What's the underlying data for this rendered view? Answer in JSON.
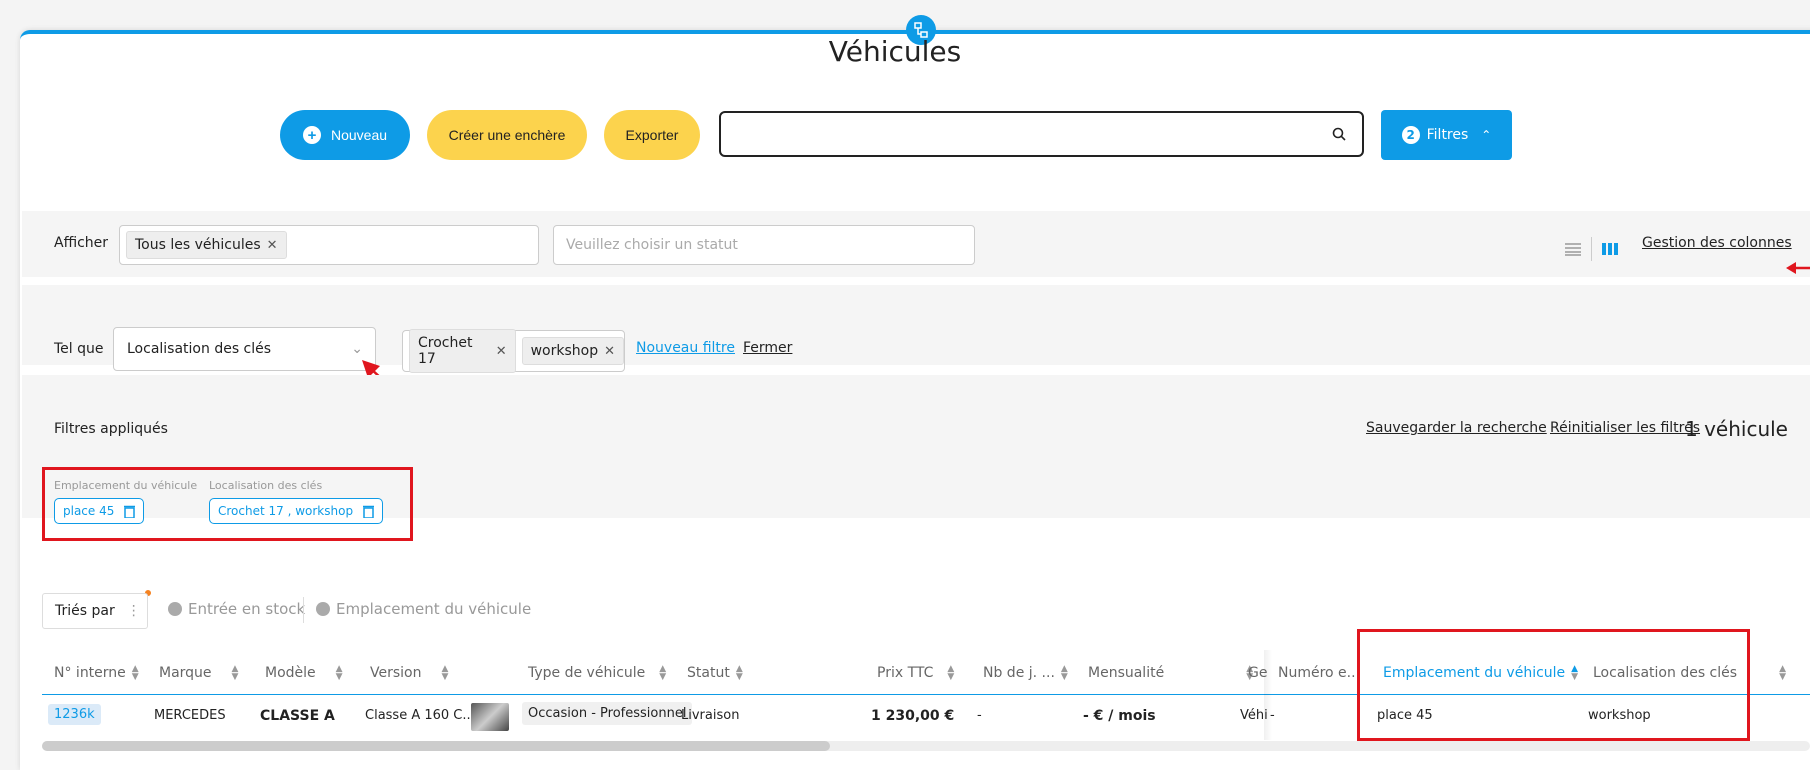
{
  "page": {
    "title": "Véhicules"
  },
  "toolbar": {
    "new_label": "Nouveau",
    "auction_label": "Créer une enchère",
    "export_label": "Exporter",
    "search_value": "",
    "filters_count": "2",
    "filters_label": "Filtres"
  },
  "display": {
    "label": "Afficher",
    "selected_chip": "Tous les véhicules",
    "status_placeholder": "Veuillez choisir un statut",
    "columns_link": "Gestion des colonnes"
  },
  "filter_row": {
    "label": "Tel que",
    "selected_field": "Localisation des clés",
    "values": [
      "Crochet 17",
      "workshop"
    ],
    "new_filter": "Nouveau filtre",
    "close": "Fermer"
  },
  "applied": {
    "label": "Filtres appliqués",
    "save_search": "Sauvegarder la recherche",
    "reset": "Réinitialiser les filtres",
    "result_count": "1 véhicule",
    "filters": [
      {
        "name": "Emplacement du véhicule",
        "value": "place 45"
      },
      {
        "name": "Localisation des clés",
        "value": "Crochet 17 , workshop"
      }
    ]
  },
  "sort": {
    "label": "Triés par",
    "items": [
      "Entrée en stock",
      "Emplacement du véhicule"
    ]
  },
  "table": {
    "headers": [
      "N° interne",
      "Marque",
      "Modèle",
      "Version",
      "Type de véhicule",
      "Statut",
      "Prix TTC",
      "Nb de j. ...",
      "Mensualité",
      "Ge",
      "Numéro e...",
      "Emplacement du véhicule",
      "Localisation des clés"
    ],
    "row": {
      "id": "1236k",
      "brand": "MERCEDES",
      "model": "CLASSE A",
      "version": "Classe A 160 C...",
      "type": "Occasion - Professionnel",
      "status": "Livraison",
      "price": "1 230,00 €",
      "days": "-",
      "monthly": "- € / mois",
      "ge": "Véhi",
      "number": "-",
      "location": "place 45",
      "keys": "workshop"
    }
  },
  "colors": {
    "accent": "#0e9be6",
    "yellow": "#fcd34d",
    "annotation": "#e0161e"
  }
}
